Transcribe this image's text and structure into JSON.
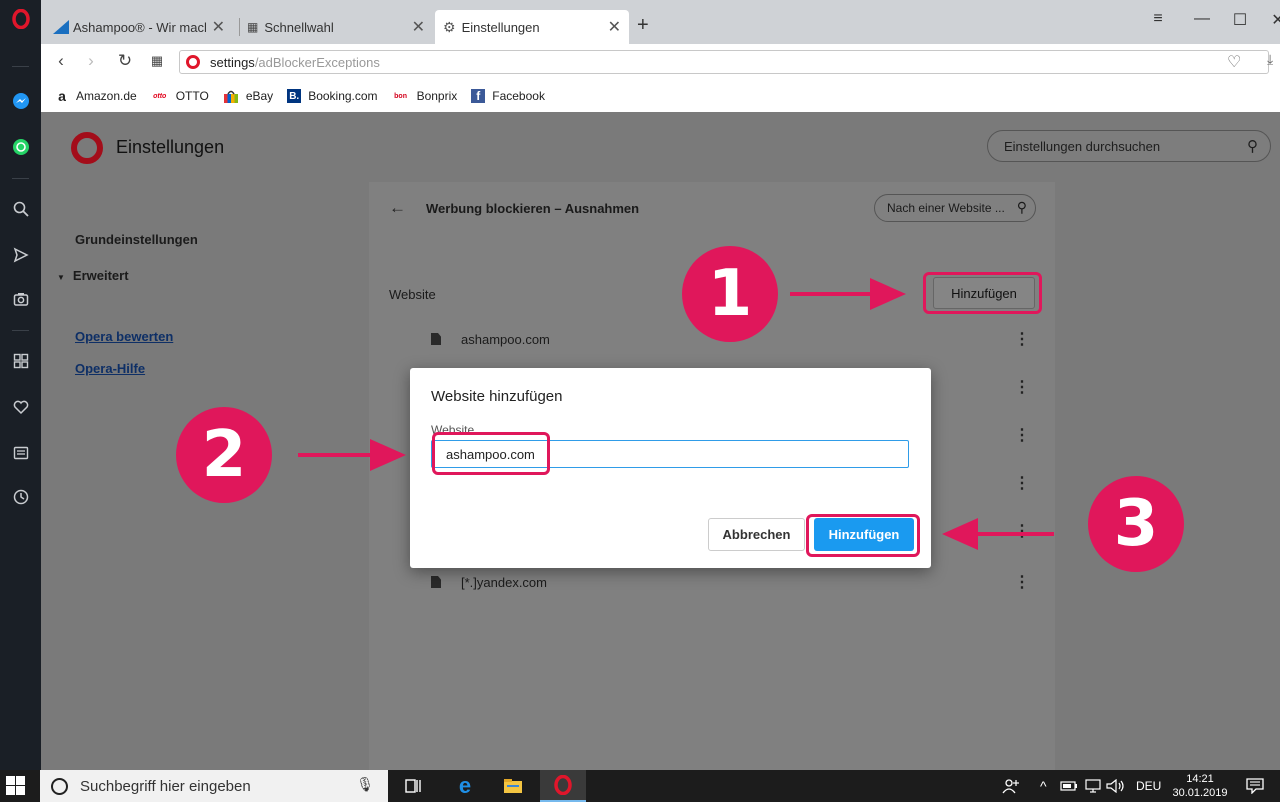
{
  "tabs": [
    {
      "title": "Ashampoo® - Wir machen",
      "close": "✕",
      "active": false
    },
    {
      "title": "Schnellwahl",
      "close": "✕",
      "active": false
    },
    {
      "title": "Einstellungen",
      "close": "✕",
      "active": true
    }
  ],
  "new_tab": "+",
  "window_controls": {
    "menu": "≡",
    "minimize": "—",
    "maximize": "☐",
    "close": "✕"
  },
  "address": {
    "host": "settings",
    "path": "/adBlockerExceptions"
  },
  "bookmarks": [
    {
      "label": "Amazon.de",
      "icon": "a",
      "icon_color": "#111111",
      "icon_bg": "#ffffff"
    },
    {
      "label": "OTTO",
      "icon": "otto",
      "icon_color": "#e1001a",
      "icon_bg": "#ffffff"
    },
    {
      "label": "eBay",
      "icon": "bag",
      "icon_color": "#e53238",
      "icon_bg": "#ffffff"
    },
    {
      "label": "Booking.com",
      "icon": "B.",
      "icon_color": "#ffffff",
      "icon_bg": "#003580"
    },
    {
      "label": "Bonprix",
      "icon": "bon",
      "icon_color": "#d4001c",
      "icon_bg": "#ffffff"
    },
    {
      "label": "Facebook",
      "icon": "f",
      "icon_color": "#ffffff",
      "icon_bg": "#3b5998"
    }
  ],
  "settings": {
    "title": "Einstellungen",
    "search_placeholder": "Einstellungen durchsuchen",
    "nav": {
      "basic": "Grundeinstellungen",
      "advanced": "Erweitert",
      "rate": "Opera bewerten",
      "help": "Opera-Hilfe"
    },
    "card": {
      "title": "Werbung blockieren – Ausnahmen",
      "search_placeholder": "Nach einer Website ...",
      "column_label": "Website",
      "add_button": "Hinzufügen",
      "rows": [
        "ashampoo.com",
        "",
        "",
        "",
        "",
        "[*.]yandex.com"
      ]
    }
  },
  "dialog": {
    "title": "Website hinzufügen",
    "label": "Website",
    "value": "ashampoo.com",
    "cancel": "Abbrechen",
    "ok": "Hinzufügen"
  },
  "annotations": {
    "step1": "1",
    "step2": "2",
    "step3": "3",
    "color": "#e0175b"
  },
  "taskbar": {
    "search_placeholder": "Suchbegriff hier eingeben",
    "language": "DEU",
    "time": "14:21",
    "date": "30.01.2019"
  }
}
